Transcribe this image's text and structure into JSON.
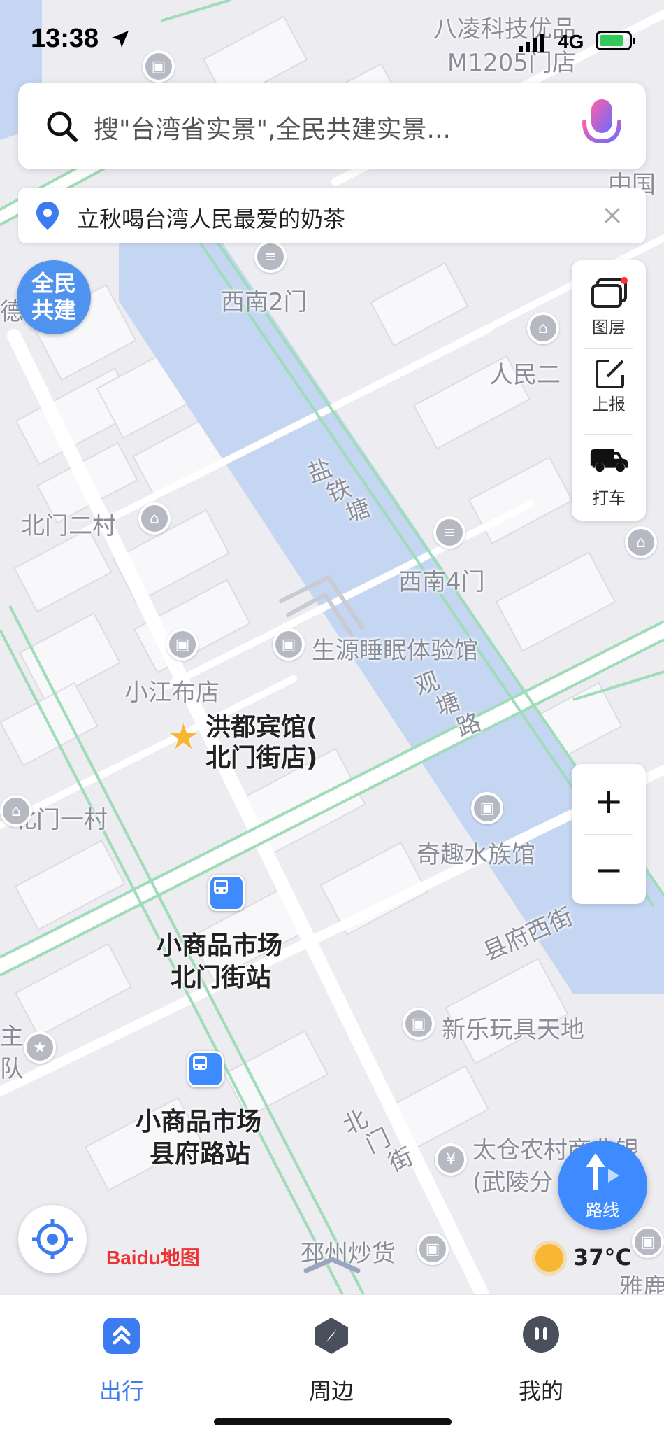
{
  "status_bar": {
    "time": "13:38",
    "network": "4G"
  },
  "search": {
    "placeholder": "搜\"台湾省实景\",全民共建实景..."
  },
  "banner": {
    "text": "立秋喝台湾人民最爱的奶茶"
  },
  "badge": {
    "line1": "全民",
    "line2": "共建"
  },
  "tools": [
    {
      "label": "图层",
      "icon": "layers-icon"
    },
    {
      "label": "上报",
      "icon": "report-icon"
    },
    {
      "label": "打车",
      "icon": "taxi-icon"
    }
  ],
  "zoom": {
    "in": "+",
    "out": "−"
  },
  "map_labels": {
    "top_store_1": "八凌科技优品",
    "top_store_2": "M1205门店",
    "china": "中国",
    "sw_gate2": "西南2门",
    "people_2": "人民二",
    "river": [
      "盐",
      "铁",
      "塘"
    ],
    "beimen_2": "北门二村",
    "sw_gate4": "西南4门",
    "shengyuan": "生源睡眠体验馆",
    "guantang": [
      "观",
      "塘",
      "路"
    ],
    "xiaojiang": "小江布店",
    "hongdu_1": "洪都宾馆(",
    "hongdu_2": "北门街店)",
    "beimen_1": "北门一村",
    "qiqu": "奇趣水族馆",
    "xianfu_w": "县府西街",
    "xinle": "新乐玩具天地",
    "bus1_1": "小商品市场",
    "bus1_2": "北门街站",
    "bus2_1": "小商品市场",
    "bus2_2": "县府路站",
    "beimenjie": [
      "北",
      "门",
      "街"
    ],
    "taicang_1": "太仓农村商业银",
    "taicang_2": "(武陵分",
    "pizhou": "邳州炒货",
    "yalu": "雅鹿",
    "left_edge_1": "德",
    "left_edge_2": "主",
    "left_edge_3": "队"
  },
  "route_button": {
    "label": "路线"
  },
  "weather": {
    "temp": "37°C"
  },
  "logo": {
    "text": "Baidu地图"
  },
  "tabs": [
    {
      "label": "出行",
      "active": true
    },
    {
      "label": "周边",
      "active": false
    },
    {
      "label": "我的",
      "active": false
    }
  ],
  "colors": {
    "accent": "#3d7bf0",
    "water": "#c5d6f2",
    "road_green": "#9fdcb8",
    "route_btn": "#3d8bff"
  }
}
